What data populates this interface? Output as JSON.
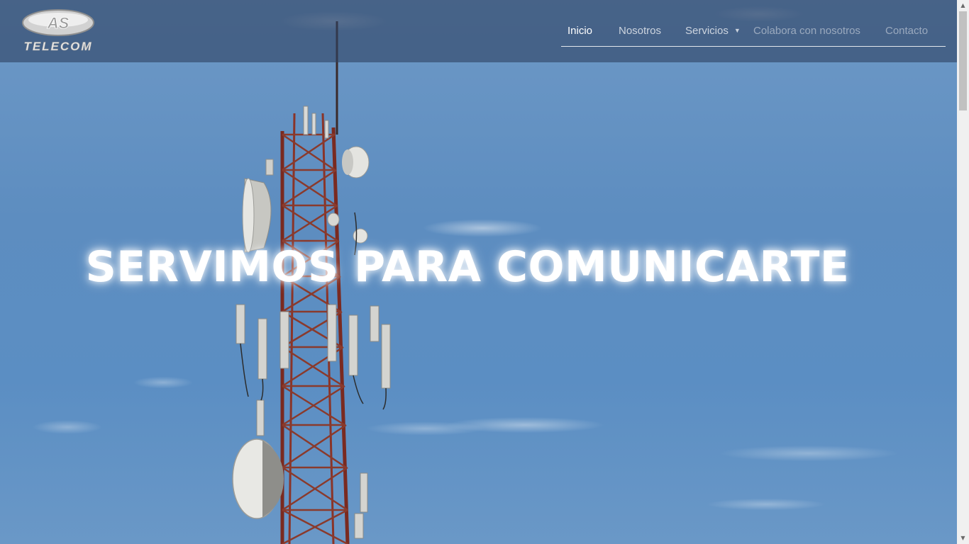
{
  "brand": {
    "logo_mark": "AS",
    "logo_text": "TELECOM"
  },
  "nav": {
    "items": [
      {
        "label": "Inicio",
        "state": "active"
      },
      {
        "label": "Nosotros",
        "state": "normal"
      },
      {
        "label": "Servicios",
        "state": "normal",
        "has_dropdown": true
      },
      {
        "label": "Colabora con nosotros",
        "state": "dimmed"
      },
      {
        "label": "Contacto",
        "state": "dimmed"
      }
    ]
  },
  "hero": {
    "headline": "SERVIMOS PARA COMUNICARTE",
    "background_image": "telecom-tower-against-blue-sky"
  },
  "colors": {
    "sky": "#5d8dc0",
    "navbar": "#2e4262",
    "tower": "#7a2a20",
    "text": "#ffffff"
  }
}
